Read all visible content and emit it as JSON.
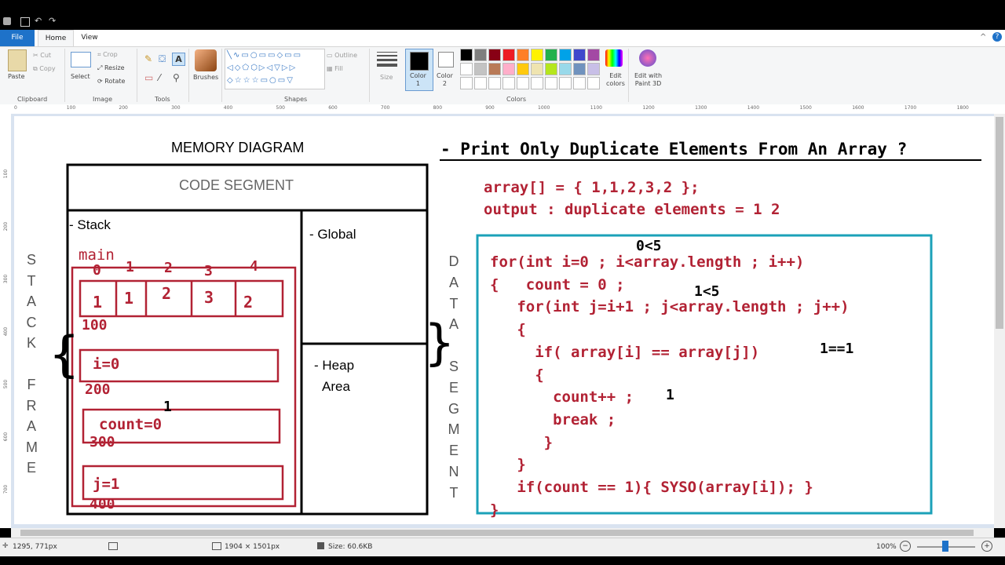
{
  "ribbon": {
    "tabs": [
      "File",
      "Home",
      "View"
    ],
    "clipboard": {
      "paste": "Paste",
      "cut": "Cut",
      "copy": "Copy",
      "group": "Clipboard"
    },
    "image": {
      "select": "Select",
      "crop": "Crop",
      "resize": "Resize",
      "rotate": "Rotate",
      "group": "Image"
    },
    "tools": {
      "group": "Tools"
    },
    "brushes": "Brushes",
    "shapes": {
      "outline": "Outline",
      "fill": "Fill",
      "group": "Shapes"
    },
    "size": "Size",
    "color1": "Color\n1",
    "color2": "Color\n2",
    "colors_group": "Colors",
    "edit_colors": "Edit\ncolors",
    "edit_paint3d": "Edit with\nPaint 3D",
    "palette_row1": [
      "#000000",
      "#7f7f7f",
      "#880015",
      "#ed1c24",
      "#ff7f27",
      "#fff200",
      "#22b14c",
      "#00a2e8",
      "#3f48cc",
      "#a349a4"
    ],
    "palette_row2": [
      "#ffffff",
      "#c3c3c3",
      "#b97a57",
      "#ffaec9",
      "#ffc90e",
      "#efe4b0",
      "#b5e61d",
      "#99d9ea",
      "#7092be",
      "#c8bfe7"
    ],
    "palette_row3": [
      "#ffffff",
      "#ffffff",
      "#ffffff",
      "#ffffff",
      "#ffffff",
      "#ffffff",
      "#ffffff",
      "#ffffff",
      "#ffffff",
      "#ffffff"
    ]
  },
  "ruler": {
    "top": [
      "0",
      "100",
      "200",
      "300",
      "400",
      "500",
      "600",
      "700",
      "800",
      "900",
      "1000",
      "1100",
      "1200",
      "1300",
      "1400",
      "1500",
      "1600",
      "1700",
      "1800"
    ],
    "left": [
      "100",
      "200",
      "300",
      "400",
      "500",
      "600",
      "700"
    ]
  },
  "diagram": {
    "title": "MEMORY DIAGRAM",
    "code_segment": "CODE SEGMENT",
    "stack": "- Stack",
    "global": "- Global",
    "heap1": "- Heap",
    "heap2": "Area",
    "stack_frame_letters": [
      "S",
      "T",
      "A",
      "C",
      "K",
      "",
      "F",
      "R",
      "A",
      "M",
      "E"
    ],
    "data_segment_letters": [
      "D",
      "A",
      "T",
      "A",
      "",
      "S",
      "E",
      "G",
      "M",
      "E",
      "N",
      "T"
    ],
    "main": "main",
    "indices": [
      "0",
      "1",
      "2",
      "3",
      "4"
    ],
    "array_values": [
      "1",
      "1",
      "2",
      "3",
      "2"
    ],
    "addr_100": "100",
    "i_var": "i=0",
    "addr_200": "200",
    "count_var": "count=0",
    "count_overwrite": "1",
    "addr_300": "300",
    "j_var": "j=1",
    "addr_400": "400"
  },
  "problem": {
    "heading": "- Print Only Duplicate Elements From An Array ?",
    "array_line": "array[] = { 1,1,2,3,2 };",
    "output_line": "output : duplicate elements = 1 2"
  },
  "code": {
    "lines": [
      "for(int i=0 ; i<array.length ; i++)",
      "{   count = 0 ;",
      "   for(int j=i+1 ; j<array.length ; j++)",
      "   {",
      "     if( array[i] == array[j])",
      "     {",
      "       count++ ;",
      "       break ;",
      "      }",
      "   }",
      "   if(count == 1){ SYSO(array[i]); }",
      "}"
    ],
    "notes": {
      "n1": "0<5",
      "n2": "1<5",
      "n3": "1==1",
      "n4": "1"
    }
  },
  "status": {
    "position": "1295, 771px",
    "dimensions": "1904 × 1501px",
    "size": "Size: 60.6KB",
    "zoom": "100%"
  }
}
